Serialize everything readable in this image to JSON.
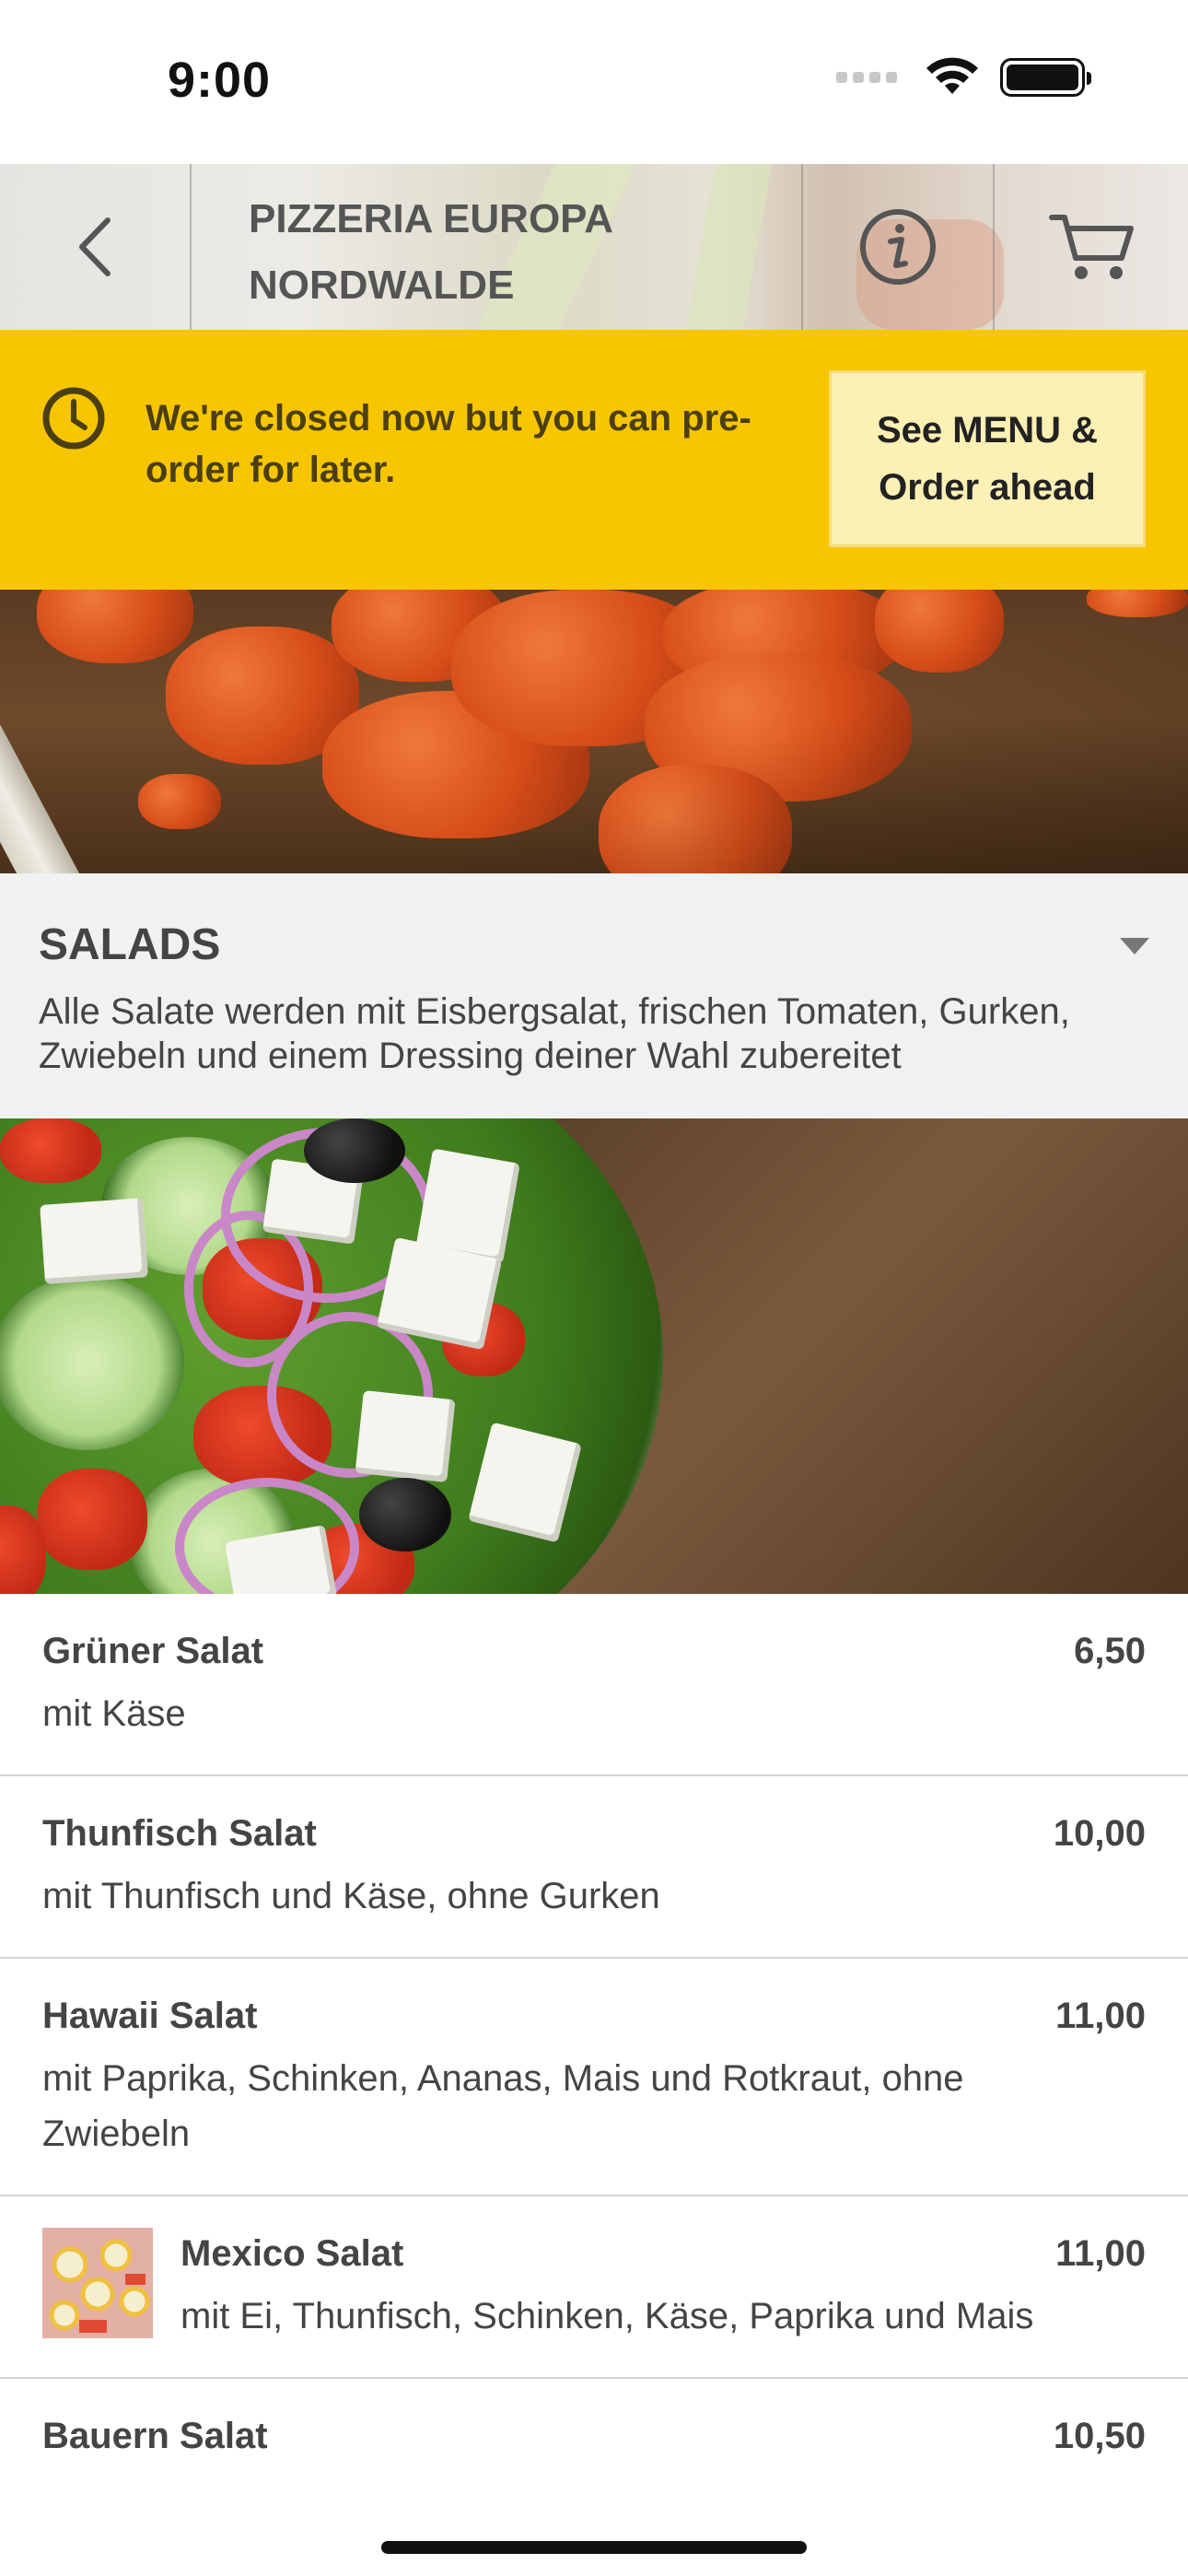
{
  "status_bar": {
    "time": "9:00"
  },
  "header": {
    "title_line1": "PIZZERIA EUROPA",
    "title_line2": "NORDWALDE"
  },
  "notice": {
    "message": "We're closed now but you can pre-order for later.",
    "button_line1": "See MENU &",
    "button_line2": "Order ahead"
  },
  "section": {
    "title": "SALADS",
    "description": "Alle Salate werden mit Eisbergsalat, frischen Tomaten, Gurken, Zwiebeln und einem Dressing deiner Wahl zubereitet"
  },
  "menu_items": [
    {
      "name": "Grüner Salat",
      "price": "6,50",
      "description": "mit Käse"
    },
    {
      "name": "Thunfisch Salat",
      "price": "10,00",
      "description": "mit Thunfisch und Käse, ohne Gurken"
    },
    {
      "name": "Hawaii Salat",
      "price": "11,00",
      "description": "mit Paprika, Schinken, Ananas, Mais und Rotkraut, ohne Zwiebeln"
    },
    {
      "name": "Mexico Salat",
      "price": "11,00",
      "description": "mit Ei, Thunfisch, Schinken, Käse, Paprika und Mais"
    },
    {
      "name": "Bauern Salat",
      "price": "10,50",
      "description": ""
    }
  ],
  "colors": {
    "accent": "#f7c600",
    "button_bg": "#fdf0b4",
    "section_bg": "#f1f1f1"
  },
  "icons": [
    "back-chevron-icon",
    "info-icon",
    "cart-icon",
    "clock-icon",
    "caret-down-icon",
    "wifi-icon",
    "battery-icon",
    "cellular-signal-icon"
  ]
}
